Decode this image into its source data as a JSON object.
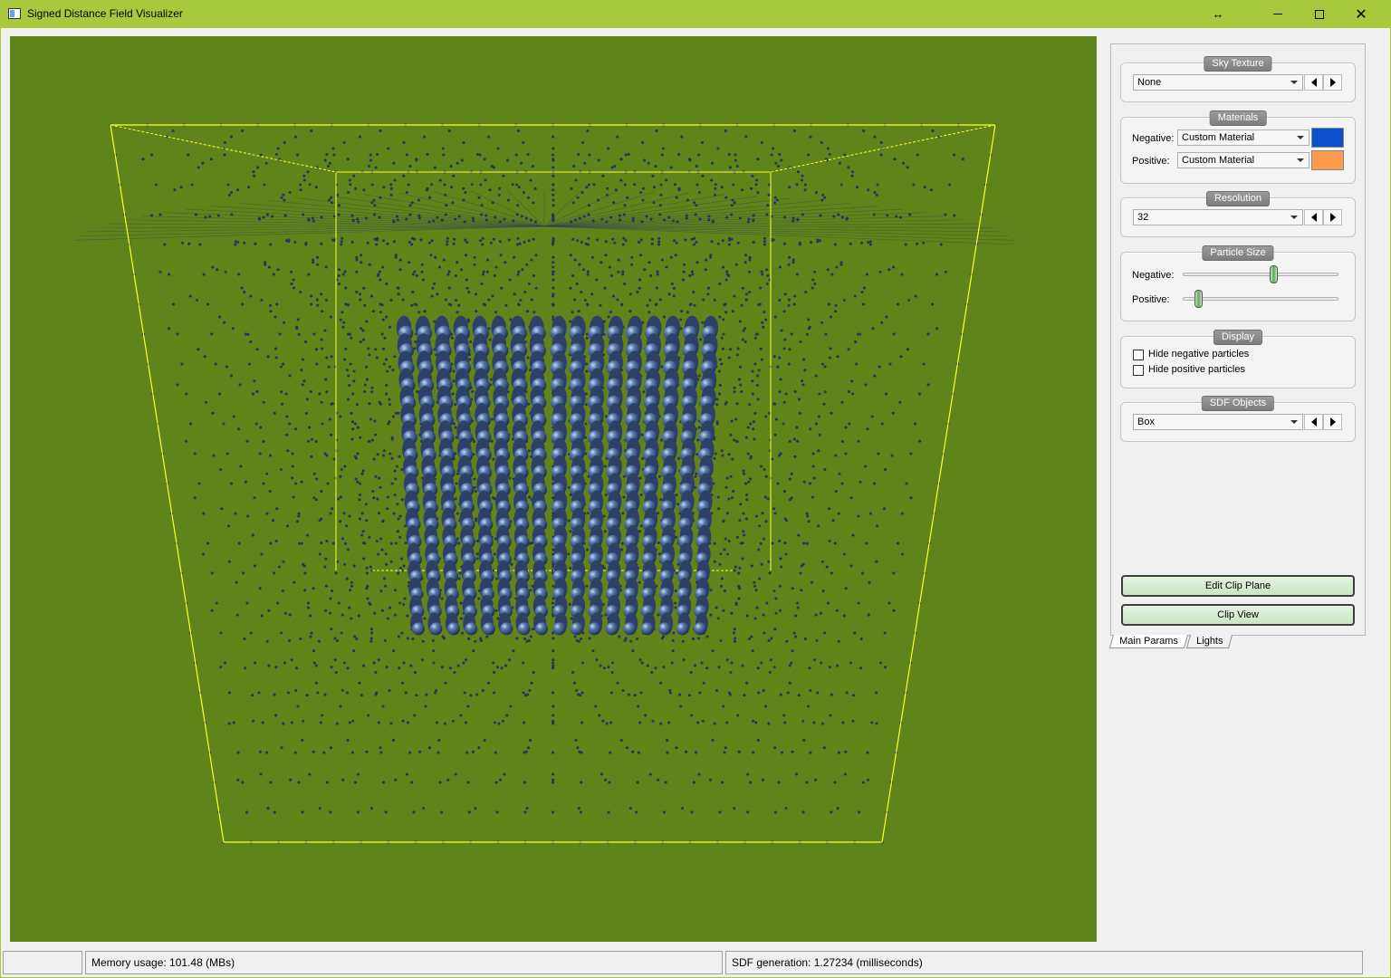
{
  "window": {
    "title": "Signed Distance Field Visualizer",
    "resize_glyph": "↔",
    "close_glyph": "✕",
    "icon": "app-window-icon"
  },
  "viewport": {
    "background": "#608419",
    "bounds_color": "#ffff33",
    "negative_particle_color": "#3a5a8c",
    "positive_particle_color": "#f0a060",
    "object_shown": "Box"
  },
  "panel": {
    "sky_texture": {
      "title": "Sky Texture",
      "value": "None"
    },
    "materials": {
      "title": "Materials",
      "negative_label": "Negative:",
      "negative_value": "Custom Material",
      "negative_color": "#0b4fcc",
      "positive_label": "Positive:",
      "positive_value": "Custom Material",
      "positive_color": "#fd9a4d"
    },
    "resolution": {
      "title": "Resolution",
      "value": "32"
    },
    "particle_size": {
      "title": "Particle Size",
      "negative_label": "Negative:",
      "negative_level": 0.58,
      "positive_label": "Positive:",
      "positive_level": 0.1
    },
    "display": {
      "title": "Display",
      "hide_negative": "Hide negative particles",
      "hide_negative_checked": false,
      "hide_positive": "Hide positive particles",
      "hide_positive_checked": false
    },
    "sdf_objects": {
      "title": "SDF Objects",
      "value": "Box"
    },
    "buttons": {
      "edit_clip_plane": "Edit Clip Plane",
      "clip_view": "Clip View"
    },
    "tabs": [
      "Main Params",
      "Lights"
    ]
  },
  "status": {
    "empty": "",
    "memory": "Memory usage: 101.48 (MBs)",
    "sdf_generation": "SDF generation: 1.27234 (milliseconds)"
  }
}
